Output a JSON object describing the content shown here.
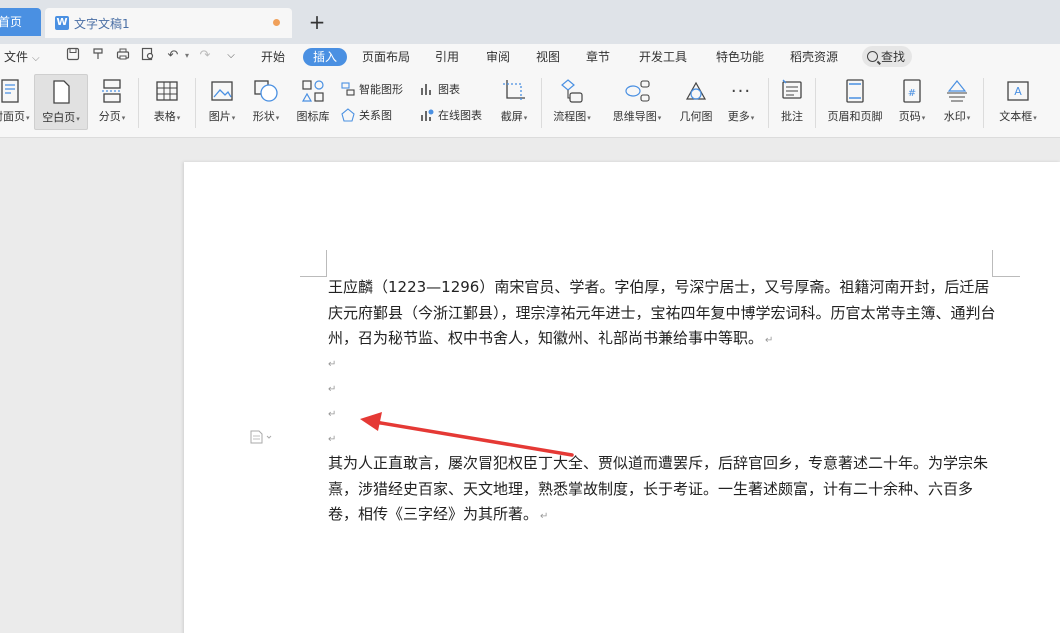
{
  "tabs": {
    "home_label": "首页",
    "doc_title": "文字文稿1",
    "doc_icon": "W",
    "add_label": "+"
  },
  "menu": {
    "file_label": "文件",
    "tabs": [
      "开始",
      "插入",
      "页面布局",
      "引用",
      "审阅",
      "视图",
      "章节",
      "开发工具",
      "特色功能",
      "稻壳资源"
    ],
    "active_tab": "插入",
    "search_label": "查找"
  },
  "ribbon": {
    "cover_page": "封面页",
    "blank_page": "空白页",
    "page_break": "分页",
    "table": "表格",
    "picture": "图片",
    "shape": "形状",
    "icon_library": "图标库",
    "smart_art": "智能图形",
    "chart": "图表",
    "relation_chart": "关系图",
    "online_chart": "在线图表",
    "screenshot": "截屏",
    "flowchart": "流程图",
    "mindmap": "思维导图",
    "geometry": "几何图",
    "more": "更多",
    "comment": "批注",
    "header_footer": "页眉和页脚",
    "page_number": "页码",
    "watermark": "水印",
    "textbox": "文本框"
  },
  "document": {
    "paragraph1": "王应麟（1223—1296）南宋官员、学者。字伯厚，号深宁居士，又号厚斋。祖籍河南开封，后迁居庆元府鄞县（今浙江鄞县），理宗淳祐元年进士，宝祐四年复中博学宏词科。历官太常寺主簿、通判台州，召为秘节监、权中书舍人，知徽州、礼部尚书兼给事中等职。",
    "paragraph2": "其为人正直敢言，屡次冒犯权臣丁大全、贾似道而遭罢斥，后辞官回乡，专意著述二十年。为学宗朱熹，涉猎经史百家、天文地理，熟悉掌故制度，长于考证。一生著述颇富，计有二十余种、六百多卷，相传《三字经》为其所著。",
    "paragraph_mark": "↵"
  },
  "colors": {
    "accent": "#4a90e2",
    "arrow": "#e53935"
  }
}
